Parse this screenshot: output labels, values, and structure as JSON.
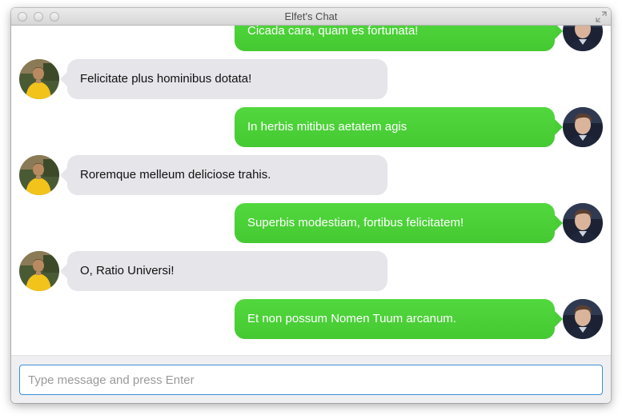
{
  "window": {
    "title": "Elfet's Chat"
  },
  "icons": {
    "fullscreen": "fullscreen-arrows-icon",
    "avatar_me": "avatar-photo",
    "avatar_contact": "avatar-photo"
  },
  "colors": {
    "outgoing_bubble": "#4cd137",
    "incoming_bubble": "#e5e5ea",
    "input_focus_border": "#3d8fd6"
  },
  "messages": [
    {
      "direction": "out",
      "text": "Cicada cara, quam es fortunata!"
    },
    {
      "direction": "in",
      "text": "Felicitate plus hominibus dotata!"
    },
    {
      "direction": "out",
      "text": "In herbis mitibus aetatem agis"
    },
    {
      "direction": "in",
      "text": "Roremque melleum deliciose trahis."
    },
    {
      "direction": "out",
      "text": "Superbis modestiam, fortibus felicitatem!"
    },
    {
      "direction": "in",
      "text": "O, Ratio Universi!"
    },
    {
      "direction": "out",
      "text": "Et non possum Nomen Tuum arcanum."
    }
  ],
  "composer": {
    "placeholder": "Type message and press Enter",
    "value": ""
  }
}
